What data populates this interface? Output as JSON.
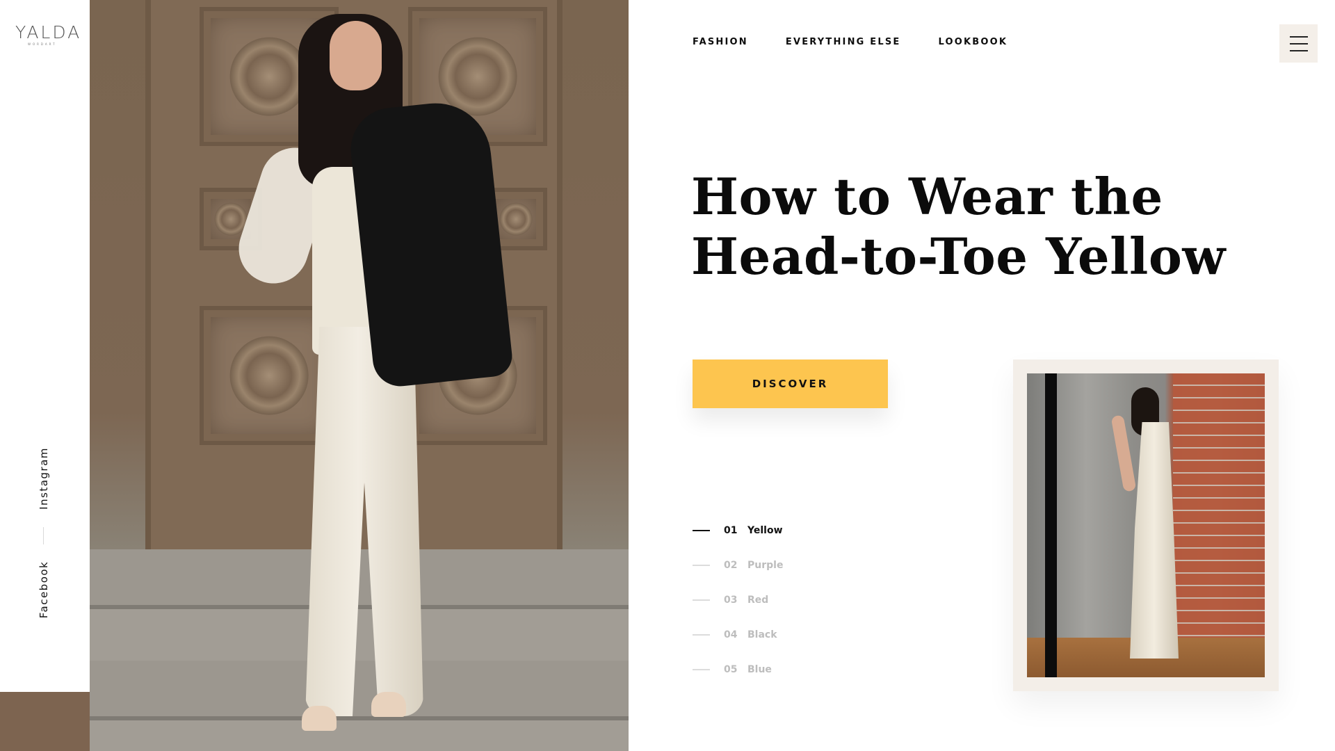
{
  "brand": {
    "logo_text": "YALDA",
    "logo_subtext": "WORDART"
  },
  "social": {
    "instagram": "Instagram",
    "facebook": "Facebook"
  },
  "nav": {
    "items": [
      "FASHION",
      "EVERYTHING ELSE",
      "LOOKBOOK"
    ]
  },
  "menu": {
    "icon": "hamburger-menu-icon"
  },
  "hero": {
    "headline_line1": "How to Wear the",
    "headline_line2": "Head-to-Toe Yellow",
    "cta_label": "DISCOVER"
  },
  "slides": [
    {
      "num": "01",
      "name": "Yellow",
      "active": true
    },
    {
      "num": "02",
      "name": "Purple",
      "active": false
    },
    {
      "num": "03",
      "name": "Red",
      "active": false
    },
    {
      "num": "04",
      "name": "Black",
      "active": false
    },
    {
      "num": "05",
      "name": "Blue",
      "active": false
    }
  ],
  "colors": {
    "accent": "#fdc54f",
    "rail_block": "#7d6450",
    "card_bg": "#f3eee8",
    "menu_bg": "#f4efe9",
    "inactive_text": "#bdbdbd"
  }
}
